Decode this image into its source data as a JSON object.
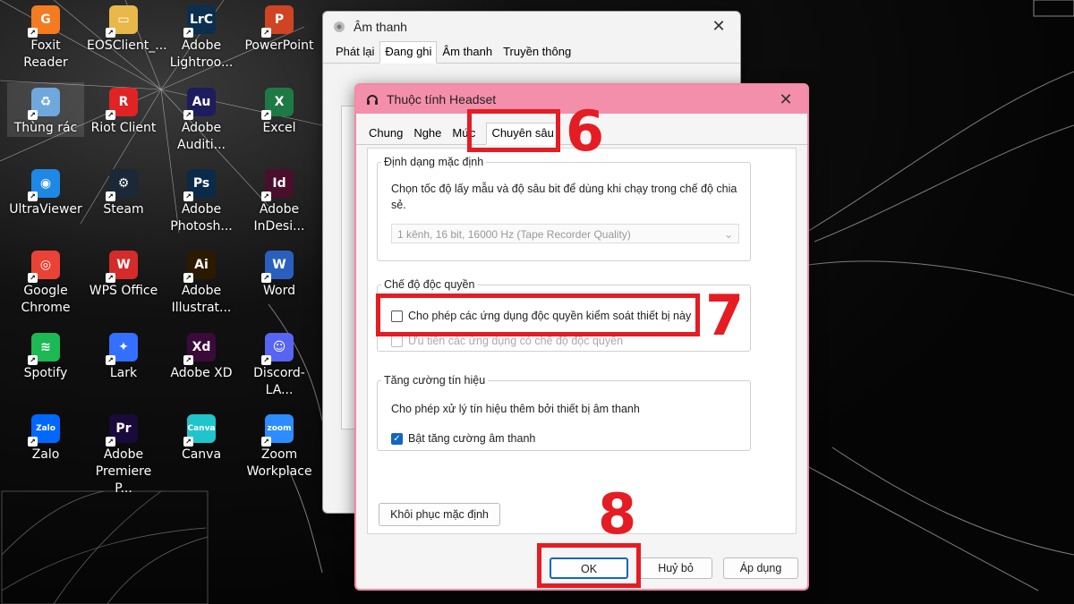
{
  "desktop": {
    "icons": [
      {
        "label": "Foxit Reader",
        "icon": "foxit-icon",
        "color": "#f47b20",
        "glyph": "G"
      },
      {
        "label": "EOSClient_...",
        "icon": "folder-icon",
        "color": "#e8b84a",
        "glyph": "▭"
      },
      {
        "label": "Adobe Lightroo...",
        "icon": "lightroom-icon",
        "color": "#0a2f4f",
        "glyph": "LrC"
      },
      {
        "label": "PowerPoint",
        "icon": "powerpoint-icon",
        "color": "#d04423",
        "glyph": "P"
      },
      {
        "label": "Thùng rác",
        "icon": "recycle-bin-icon",
        "color": "#6fa8dc",
        "glyph": "♻"
      },
      {
        "label": "Riot Client",
        "icon": "riot-icon",
        "color": "#e02424",
        "glyph": "R"
      },
      {
        "label": "Adobe Auditi...",
        "icon": "audition-icon",
        "color": "#1d1d5e",
        "glyph": "Au"
      },
      {
        "label": "Excel",
        "icon": "excel-icon",
        "color": "#1e7a45",
        "glyph": "X"
      },
      {
        "label": "UltraViewer",
        "icon": "ultraviewer-icon",
        "color": "#1e88e5",
        "glyph": "◉"
      },
      {
        "label": "Steam",
        "icon": "steam-icon",
        "color": "#1b2838",
        "glyph": "⚙"
      },
      {
        "label": "Adobe Photosh...",
        "icon": "photoshop-icon",
        "color": "#0a2a4a",
        "glyph": "Ps"
      },
      {
        "label": "Adobe InDesi...",
        "icon": "indesign-icon",
        "color": "#4a0f2a",
        "glyph": "Id"
      },
      {
        "label": "Google Chrome",
        "icon": "chrome-icon",
        "color": "#ea4335",
        "glyph": "◎"
      },
      {
        "label": "WPS Office",
        "icon": "wps-icon",
        "color": "#d62b2b",
        "glyph": "W"
      },
      {
        "label": "Adobe Illustrat...",
        "icon": "illustrator-icon",
        "color": "#2b1a00",
        "glyph": "Ai"
      },
      {
        "label": "Word",
        "icon": "word-icon",
        "color": "#2b5fbd",
        "glyph": "W"
      },
      {
        "label": "Spotify",
        "icon": "spotify-icon",
        "color": "#1db954",
        "glyph": "≋"
      },
      {
        "label": "Lark",
        "icon": "lark-icon",
        "color": "#3370ff",
        "glyph": "✦"
      },
      {
        "label": "Adobe XD",
        "icon": "xd-icon",
        "color": "#3a0a3a",
        "glyph": "Xd"
      },
      {
        "label": "Discord-LA...",
        "icon": "discord-icon",
        "color": "#5865f2",
        "glyph": "☺"
      },
      {
        "label": "Zalo",
        "icon": "zalo-icon",
        "color": "#0068ff",
        "glyph": "Zalo"
      },
      {
        "label": "Adobe Premiere P...",
        "icon": "premiere-icon",
        "color": "#1a0a3a",
        "glyph": "Pr"
      },
      {
        "label": "Canva",
        "icon": "canva-icon",
        "color": "#20c4cb",
        "glyph": "Canva"
      },
      {
        "label": "Zoom Workplace",
        "icon": "zoom-icon",
        "color": "#2d8cff",
        "glyph": "zoom"
      }
    ]
  },
  "sound_window": {
    "title": "Âm thanh",
    "tabs": [
      "Phát lại",
      "Đang ghi",
      "Âm thanh",
      "Truyền thông"
    ],
    "active_tab": 1
  },
  "props_window": {
    "title": "Thuộc tính Headset",
    "tabs": [
      "Chung",
      "Nghe",
      "Mức",
      "Chuyên sâu"
    ],
    "active_tab": 3,
    "default_format": {
      "legend": "Định dạng mặc định",
      "description": "Chọn tốc độ lấy mẫu và độ sâu bit để dùng khi chạy trong chế độ chia sẻ.",
      "selected": "1 kênh, 16 bit, 16000 Hz (Tape Recorder Quality)"
    },
    "exclusive_mode": {
      "legend": "Chế độ độc quyền",
      "allow_label": "Cho phép các ứng dụng độc quyền kiểm soát thiết bị này",
      "allow_checked": false,
      "priority_label": "Ưu tiên các ứng dụng có chế độ độc quyền",
      "priority_checked": false
    },
    "signal_enhance": {
      "legend": "Tăng cường tín hiệu",
      "description": "Cho phép xử lý tín hiệu thêm bởi thiết bị âm thanh",
      "enable_label": "Bật tăng cường âm thanh",
      "enable_checked": true
    },
    "restore_label": "Khôi phục mặc định",
    "ok_label": "OK",
    "cancel_label": "Huỷ bỏ",
    "apply_label": "Áp dụng"
  },
  "annotations": {
    "step6": "6",
    "step7": "7",
    "step8": "8",
    "color": "#e51c23"
  }
}
